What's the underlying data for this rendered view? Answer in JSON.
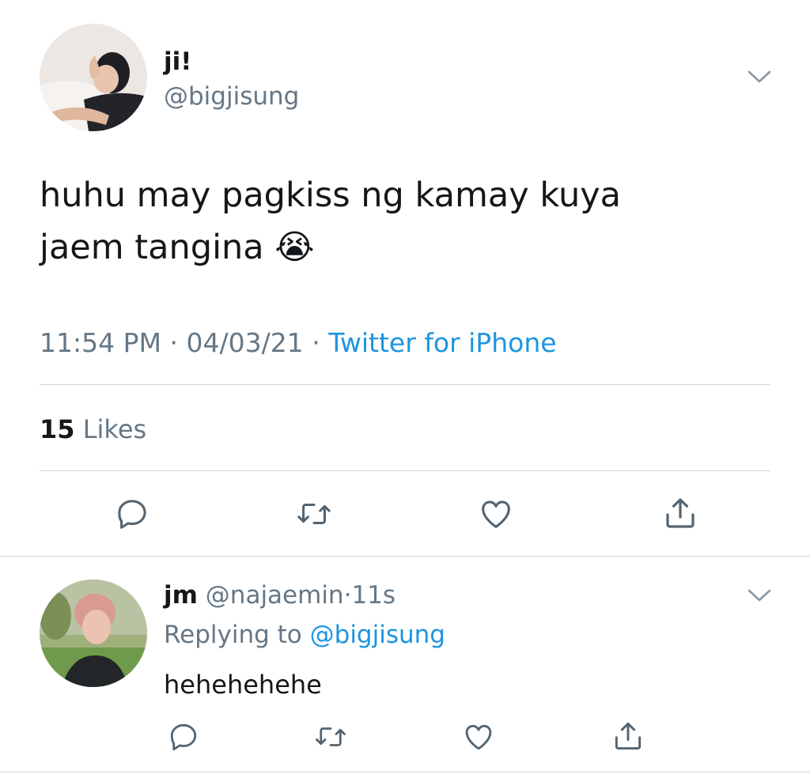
{
  "tweet": {
    "display_name": "ji!",
    "handle": "@bigjisung",
    "text_line1": "huhu may pagkiss ng kamay kuya",
    "text_line2": "jaem tangina",
    "emoji": "😭",
    "time": "11:54 PM",
    "sep1": "·",
    "date": "04/03/21",
    "sep2": "·",
    "source": "Twitter for iPhone",
    "likes_count": "15",
    "likes_label": "Likes",
    "actions": [
      "reply-icon",
      "retweet-icon",
      "like-icon",
      "share-icon"
    ]
  },
  "reply": {
    "display_name": "jm",
    "handle": "@najaemin",
    "sep": "·",
    "time": "11s",
    "replying_prefix": "Replying to",
    "replying_handle": "@bigjisung",
    "text": "hehehehehe",
    "actions": [
      "reply-icon",
      "retweet-icon",
      "like-icon",
      "share-icon"
    ]
  },
  "colors": {
    "text": "#14171a",
    "secondary": "#657786",
    "link": "#1b95e0",
    "divider": "#ccd6dd"
  }
}
